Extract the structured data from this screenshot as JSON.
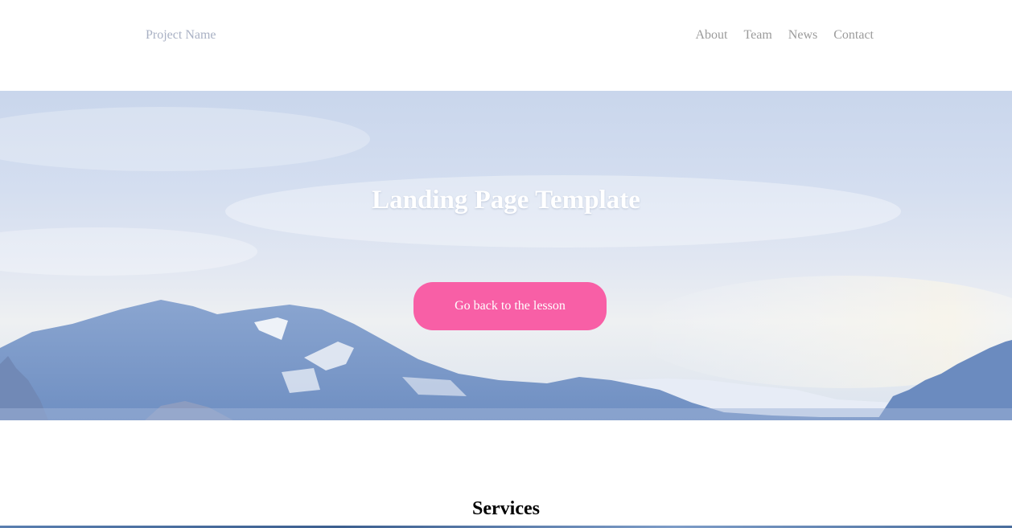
{
  "navbar": {
    "brand": "Project Name",
    "links": [
      {
        "label": "About"
      },
      {
        "label": "Team"
      },
      {
        "label": "News"
      },
      {
        "label": "Contact"
      }
    ]
  },
  "hero": {
    "title": "Landing Page Template",
    "button_label": "Go back to the lesson"
  },
  "services": {
    "title": "Services"
  },
  "colors": {
    "accent": "#f85fa6",
    "brand_text": "#a9b1c4",
    "nav_text": "#9b9b9b"
  }
}
